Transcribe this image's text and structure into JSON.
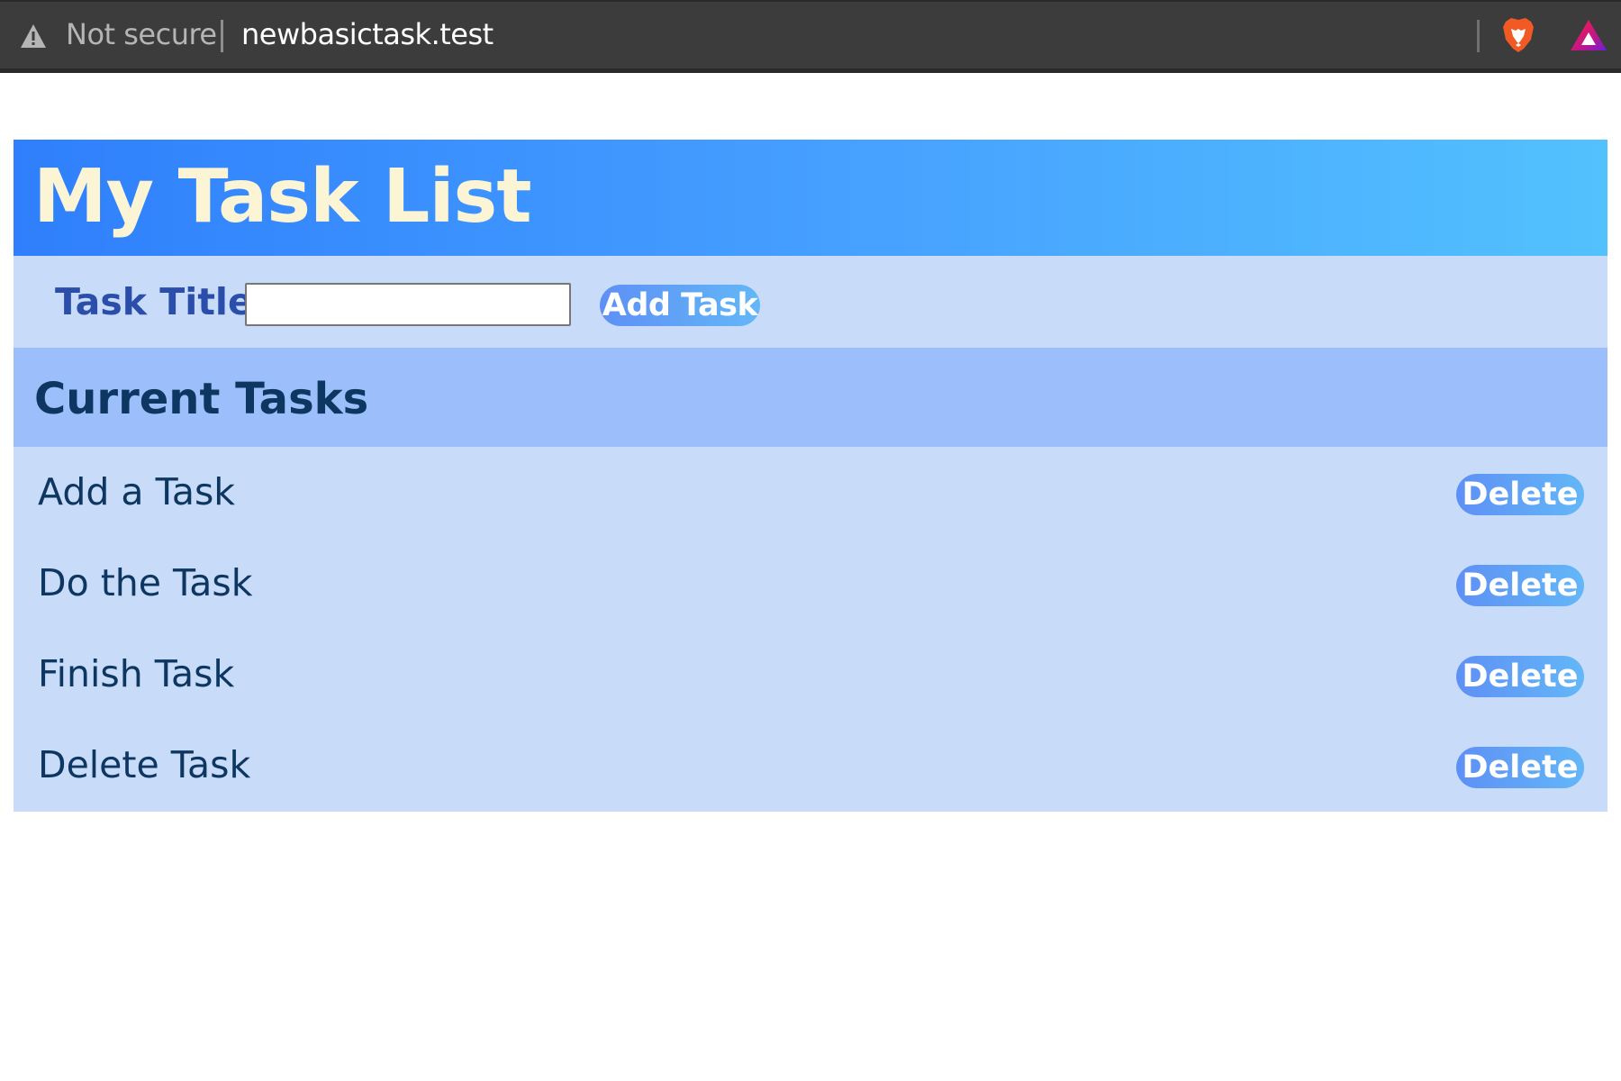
{
  "browser": {
    "security_text": "Not secure",
    "url": "newbasictask.test",
    "icons": [
      "warning-icon",
      "brave-lion-icon",
      "brave-rewards-icon"
    ]
  },
  "app": {
    "title": "My Task List",
    "form": {
      "label": "Task Title",
      "input_value": "",
      "add_button_label": "Add Task"
    },
    "section_title": "Current Tasks",
    "tasks": [
      {
        "title": "Add a Task",
        "delete_label": "Delete"
      },
      {
        "title": "Do the Task",
        "delete_label": "Delete"
      },
      {
        "title": "Finish Task",
        "delete_label": "Delete"
      },
      {
        "title": "Delete Task",
        "delete_label": "Delete"
      }
    ]
  },
  "colors": {
    "header_gradient_start": "#2f7ffc",
    "header_gradient_end": "#52c1fd",
    "title_text": "#fbf5d6",
    "panel_bg": "#c8dbf9",
    "section_header_bg": "#9cbffc",
    "button_bg": "#5e90f6",
    "text_dark": "#0d3761"
  }
}
